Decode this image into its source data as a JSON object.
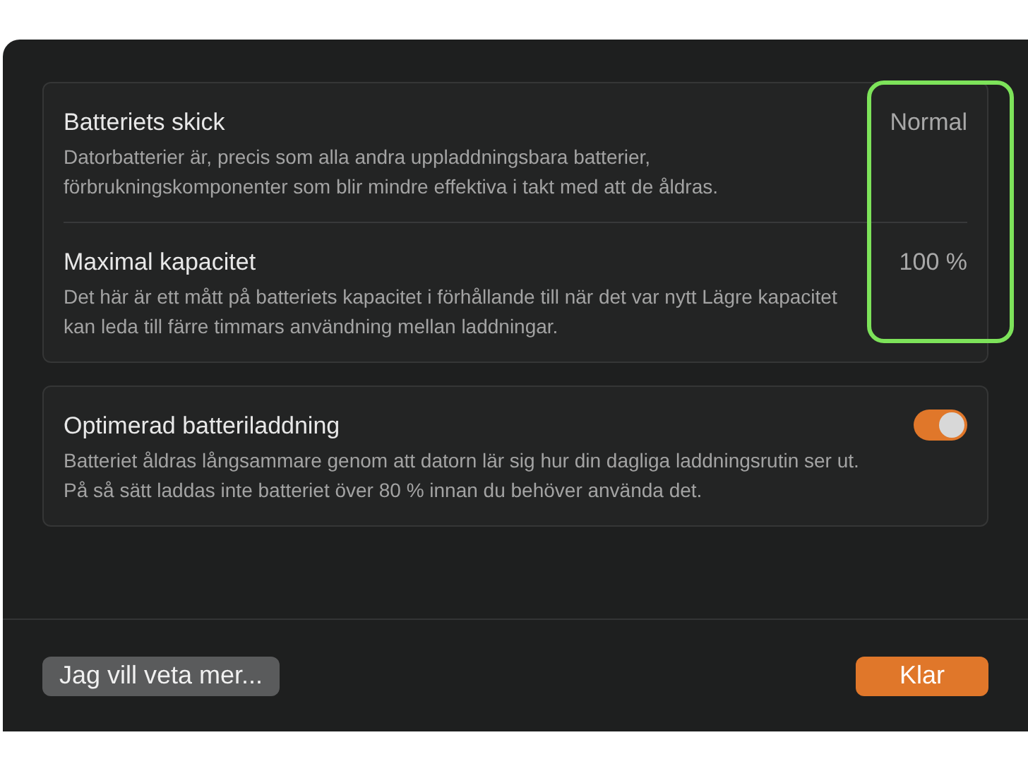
{
  "battery_card": {
    "rows": [
      {
        "title": "Batteriets skick",
        "description": "Datorbatterier är, precis som alla andra uppladdningsbara batterier, förbrukningskomponenter som blir mindre effektiva i takt med att de åldras.",
        "value": "Normal"
      },
      {
        "title": "Maximal kapacitet",
        "description": "Det här är ett mått på batteriets kapacitet i förhållande till när det var nytt Lägre kapacitet kan leda till färre timmars användning mellan laddningar.",
        "value": "100 %"
      }
    ]
  },
  "charging_card": {
    "title": "Optimerad batteriladdning",
    "description": "Batteriet åldras långsammare genom att datorn lär sig hur din dagliga laddningsrutin ser ut. På så sätt laddas inte batteriet över 80 % innan du behöver använda det.",
    "on": true
  },
  "buttons": [
    {
      "label": "Jag vill veta mer...",
      "kind": "secondary"
    },
    {
      "label": "Klar",
      "kind": "primary"
    }
  ]
}
